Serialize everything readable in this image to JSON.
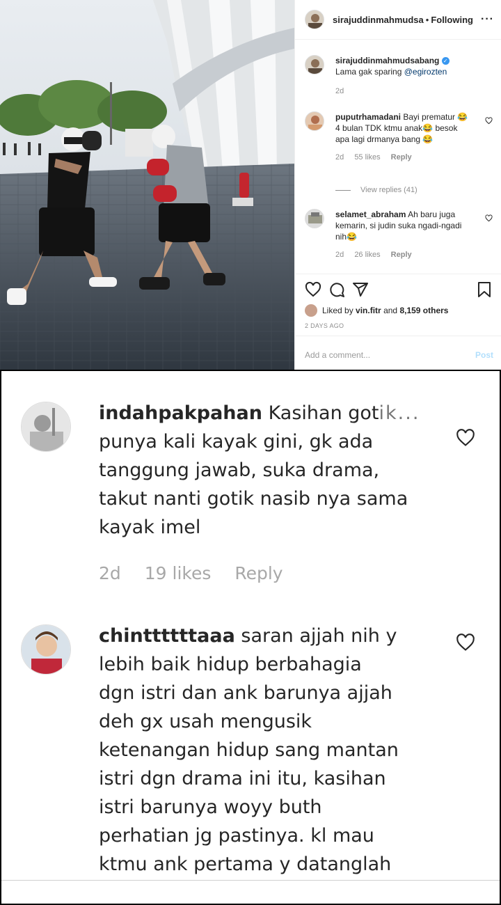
{
  "post": {
    "header": {
      "username": "sirajuddinmahmudsa",
      "separator": "•",
      "follow_label": "Following",
      "more_label": "···"
    },
    "caption": {
      "username": "sirajuddinmahmudsabang",
      "verified_mark": "✓",
      "text": "Lama gak sparing",
      "mention": "@egirozten",
      "time": "2d"
    },
    "comments": [
      {
        "username": "puputrhamadani",
        "text": "Bayi prematur 😂4 bulan TDK ktmu anak😂 besok apa lagi drmanya bang 😂",
        "time": "2d",
        "likes": "55 likes",
        "reply": "Reply"
      },
      {
        "username": "selamet_abraham",
        "text": "Ah baru juga kemarin, si judin suka ngadi-ngadi nih😂",
        "time": "2d",
        "likes": "26 likes",
        "reply": "Reply"
      }
    ],
    "view_replies": "View replies (41)",
    "liked_by_prefix": "Liked by",
    "liked_by_user": "vin.fitr",
    "liked_by_suffix": "and",
    "liked_by_count": "8,159 others",
    "timestamp": "2 DAYS AGO",
    "add_comment_placeholder": "Add a comment...",
    "post_button": "Post"
  },
  "zoomed_comments": [
    {
      "username": "indahpakpahan",
      "text": "Kasihan got",
      "ellipsis": "ik...",
      "lines": [
        "punya kali kayak gini, gk ada",
        "tanggung jawab, suka drama,",
        "takut nanti gotik nasib nya sama",
        "kayak imel"
      ],
      "time": "2d",
      "likes": "19 likes",
      "reply": "Reply"
    },
    {
      "username": "chinttttttaaa",
      "text": "saran ajjah nih y",
      "lines": [
        "lebih baik hidup berbahagia",
        "dgn istri dan ank barunya ajjah",
        "deh gx usah mengusik",
        "ketenangan hidup sang mantan",
        "istri dgn drama ini itu, kasihan",
        "istri barunya woyy buth",
        "perhatian jg pastinya. kl mau",
        "ktmu ank pertama y datanglah"
      ]
    }
  ],
  "colors": {
    "link": "#00376b",
    "meta": "#8e8e8e",
    "verified": "#3897f0",
    "post_button": "#b2dffc"
  }
}
